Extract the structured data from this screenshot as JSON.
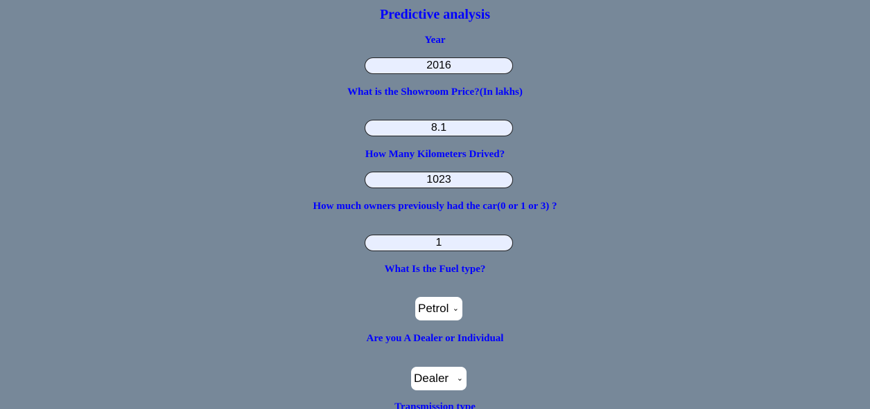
{
  "page": {
    "title": "Predictive analysis"
  },
  "form": {
    "year": {
      "label": "Year",
      "value": "2016"
    },
    "showroom_price": {
      "label": "What is the Showroom Price?(In lakhs)",
      "value": "8.1"
    },
    "kilometers": {
      "label": "How Many Kilometers Drived?",
      "value": "1023"
    },
    "owners": {
      "label": "How much owners previously had the car(0 or 1 or 3) ?",
      "value": "1"
    },
    "fuel_type": {
      "label": "What Is the Fuel type?",
      "selected": "Petrol"
    },
    "seller_type": {
      "label": "Are you A Dealer or Individual",
      "selected": "Dealer"
    },
    "transmission": {
      "label": "Transmission type"
    }
  },
  "icons": {
    "dropdown": "chevron-down-icon"
  }
}
